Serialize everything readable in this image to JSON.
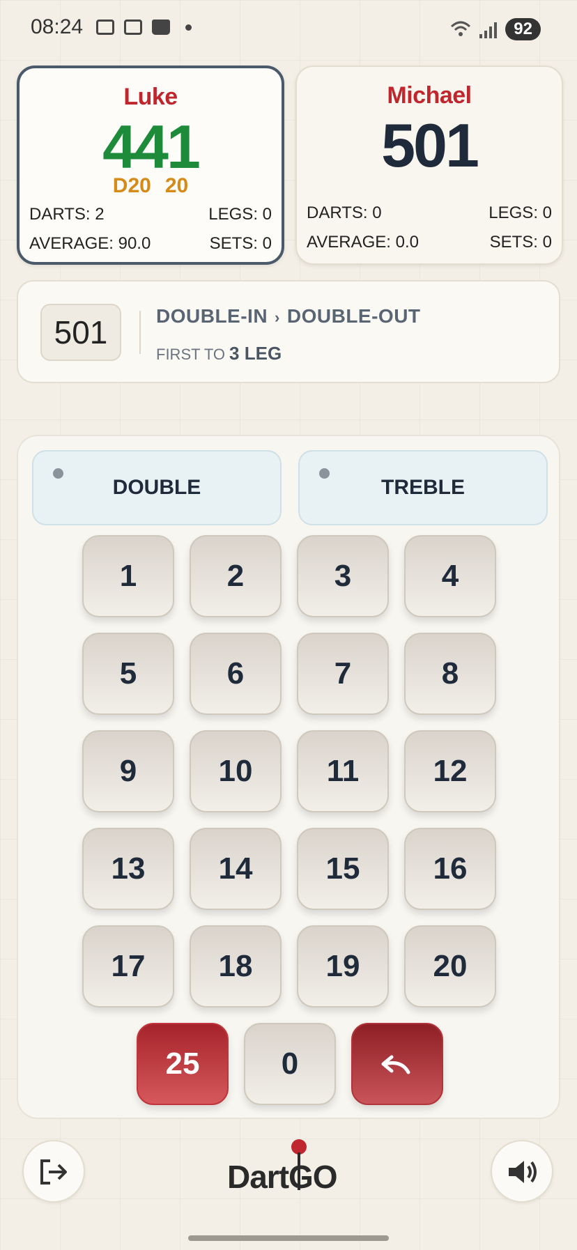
{
  "status_bar": {
    "time": "08:24",
    "battery": "92"
  },
  "players": [
    {
      "name": "Luke",
      "score": "441",
      "checkout": [
        "D20",
        "20"
      ],
      "darts_label": "DARTS: 2",
      "legs_label": "LEGS: 0",
      "average_label": "AVERAGE: 90.0",
      "sets_label": "SETS: 0"
    },
    {
      "name": "Michael",
      "score": "501",
      "darts_label": "DARTS: 0",
      "legs_label": "LEGS: 0",
      "average_label": "AVERAGE: 0.0",
      "sets_label": "SETS: 0"
    }
  ],
  "game": {
    "start_score": "501",
    "mode_in": "DOUBLE-IN",
    "mode_out": "DOUBLE-OUT",
    "first_to_label": "FIRST TO",
    "first_to_value": "3 LEG"
  },
  "modifiers": {
    "double": "DOUBLE",
    "treble": "TREBLE"
  },
  "keys": [
    "1",
    "2",
    "3",
    "4",
    "5",
    "6",
    "7",
    "8",
    "9",
    "10",
    "11",
    "12",
    "13",
    "14",
    "15",
    "16",
    "17",
    "18",
    "19",
    "20"
  ],
  "special_keys": {
    "bull": "25",
    "miss": "0",
    "undo": "↶"
  },
  "logo": {
    "text": "DartGO"
  },
  "colors": {
    "accent_red": "#c0262d",
    "active_score": "#1e8b3a",
    "checkout": "#d68a17"
  }
}
